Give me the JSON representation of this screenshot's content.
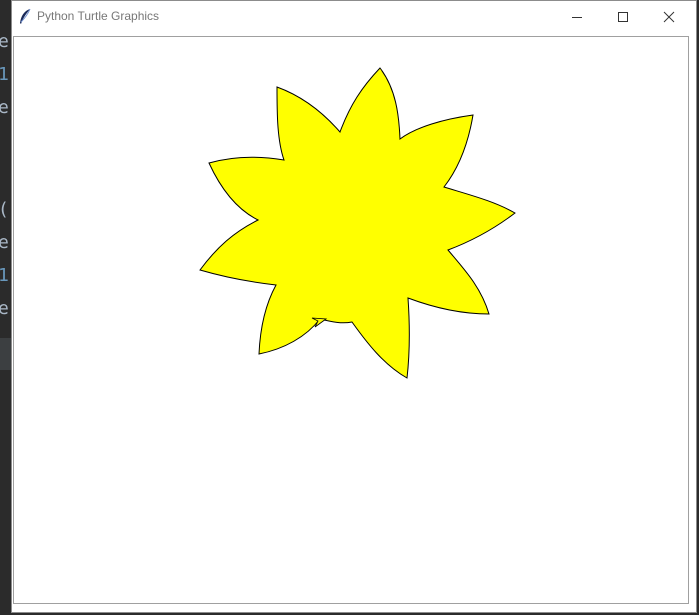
{
  "window": {
    "title": "Python Turtle Graphics"
  },
  "editor_behind": {
    "chars": [
      {
        "text": "e",
        "color": "#a9b7c6"
      },
      {
        "text": "1",
        "color": "#6897bb"
      },
      {
        "text": "e",
        "color": "#a9b7c6"
      },
      {
        "text": "(",
        "color": "#a9b7c6"
      },
      {
        "text": "e",
        "color": "#a9b7c6"
      },
      {
        "text": "1",
        "color": "#6897bb"
      },
      {
        "text": "e",
        "color": "#a9b7c6"
      }
    ]
  },
  "titlebar_buttons": {
    "minimize_icon": "minimize-icon",
    "maximize_icon": "maximize-icon",
    "close_icon": "close-icon"
  },
  "canvas": {
    "background": "#ffffff",
    "shape": {
      "type": "star",
      "points": 9,
      "fill": "#ffff00",
      "stroke": "#000000"
    },
    "turtle_cursor": "arrow-icon"
  }
}
